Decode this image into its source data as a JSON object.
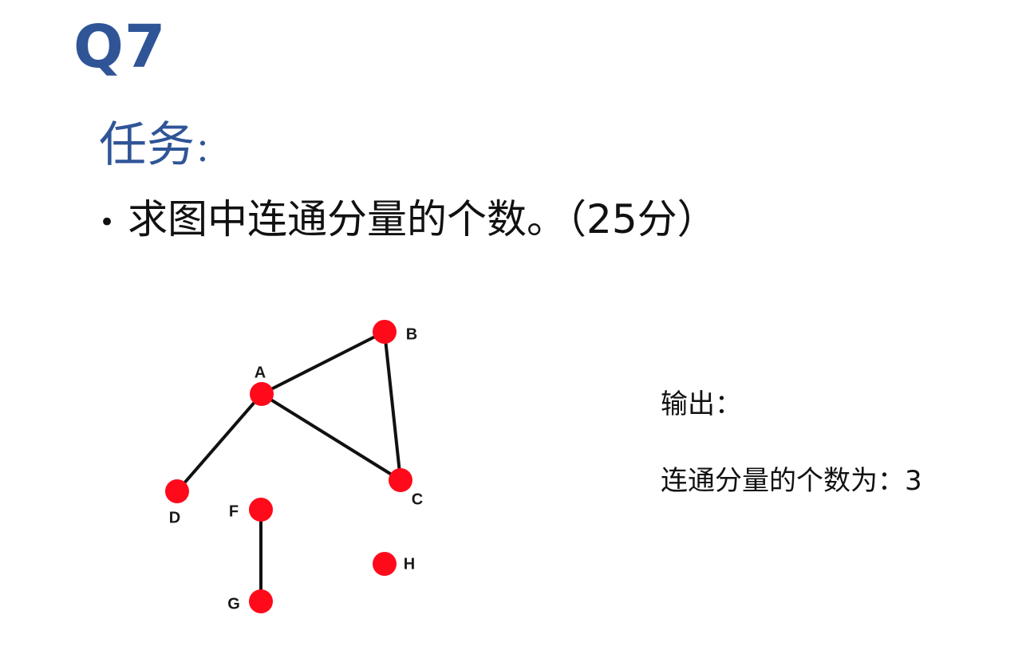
{
  "slide": {
    "title": "Q7",
    "task_heading": "任务",
    "task_heading_colon": "：",
    "bullet": "•",
    "task_text": "求图中连通分量的个数。（25分）",
    "output_label": "输出：",
    "output_result": "连通分量的个数为：3"
  },
  "graph": {
    "nodes": [
      {
        "id": "A",
        "label": "A"
      },
      {
        "id": "B",
        "label": "B"
      },
      {
        "id": "C",
        "label": "C"
      },
      {
        "id": "D",
        "label": "D"
      },
      {
        "id": "F",
        "label": "F"
      },
      {
        "id": "G",
        "label": "G"
      },
      {
        "id": "H",
        "label": "H"
      }
    ],
    "edges": [
      {
        "from": "A",
        "to": "B"
      },
      {
        "from": "A",
        "to": "C"
      },
      {
        "from": "B",
        "to": "C"
      },
      {
        "from": "A",
        "to": "D"
      },
      {
        "from": "F",
        "to": "G"
      }
    ],
    "node_color": "#ff0a1a",
    "edge_color": "#111111"
  }
}
